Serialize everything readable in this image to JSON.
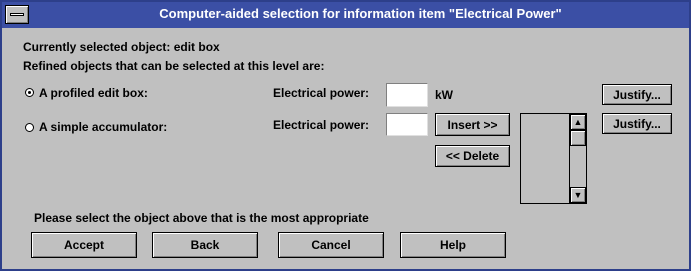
{
  "window": {
    "title": "Computer-aided selection for information item \"Electrical Power\"",
    "title_bar_color": "#3b4fa5",
    "background_color": "#c0c0c0"
  },
  "info": {
    "current_object": "Currently selected object: edit box",
    "refined_heading": "Refined objects that can be selected at this level are:"
  },
  "options": [
    {
      "label": "A profiled edit box:",
      "selected": true,
      "field_label": "Electrical power:",
      "field_value": "",
      "unit": "kW",
      "justify_label": "Justify..."
    },
    {
      "label": "A simple accumulator:",
      "selected": false,
      "field_label": "Electrical power:",
      "field_value": "",
      "justify_label": "Justify..."
    }
  ],
  "list_controls": {
    "insert_label": "Insert >>",
    "delete_label": "<< Delete",
    "scroll_up_icon": "arrow-up-icon",
    "scroll_down_icon": "arrow-down-icon"
  },
  "prompt": "Please select the object above that is the most appropriate",
  "footer_buttons": {
    "accept": "Accept",
    "back": "Back",
    "cancel": "Cancel",
    "help": "Help"
  }
}
